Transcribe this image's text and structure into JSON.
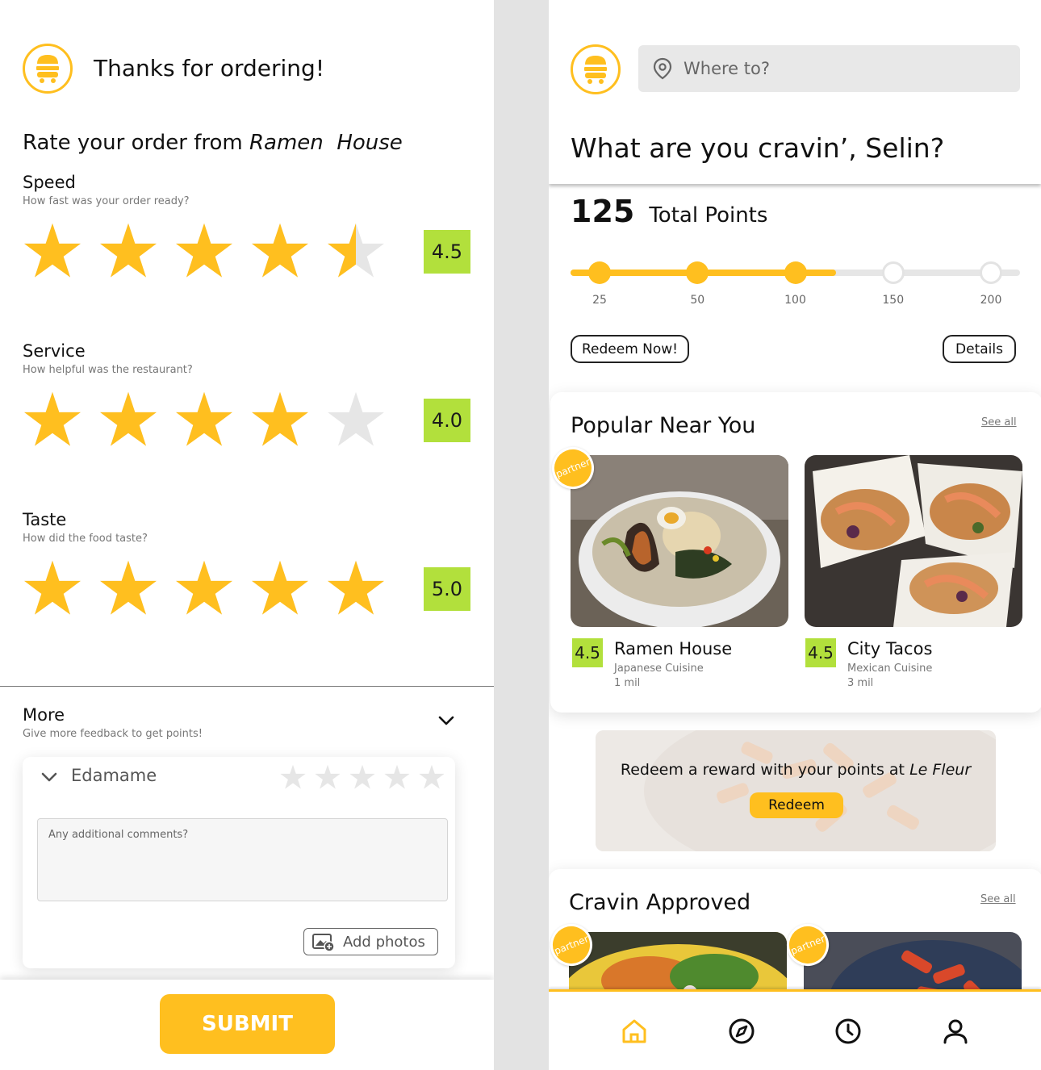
{
  "colors": {
    "accent": "#ffbf1f",
    "rating_green": "#b2e03c",
    "star_empty": "#e6e6e6"
  },
  "left": {
    "header_title": "Thanks for ordering!",
    "rate_prefix": "Rate your order from ",
    "restaurant_name": "Ramen  House",
    "categories": [
      {
        "title": "Speed",
        "subtitle": "How fast was your order ready?",
        "rating": 4.5,
        "score": "4.5"
      },
      {
        "title": "Service",
        "subtitle": "How helpful was the restaurant?",
        "rating": 4.0,
        "score": "4.0"
      },
      {
        "title": "Taste",
        "subtitle": "How did the food taste?",
        "rating": 5.0,
        "score": "5.0"
      }
    ],
    "more": {
      "title": "More",
      "subtitle": "Give more feedback to get points!",
      "item_name": "Edamame",
      "item_rating": 0,
      "comment_placeholder": "Any additional comments?",
      "add_photos_label": "Add photos"
    },
    "submit_label": "SUBMIT"
  },
  "right": {
    "search_placeholder": "Where to?",
    "greeting": "What are you cravin’, Selin?",
    "points_value": "125",
    "points_label": "Total Points",
    "progress": {
      "milestones": [
        "25",
        "50",
        "100",
        "150",
        "200"
      ],
      "reached_count": 3,
      "fill_fraction": 0.59
    },
    "redeem_now_label": "Redeem Now!",
    "details_label": "Details",
    "popular": {
      "title": "Popular Near You",
      "see_all": "See all",
      "partner_label": "partner",
      "items": [
        {
          "rating": "4.5",
          "name": "Ramen House",
          "cuisine": "Japanese Cuisine",
          "distance": "1 mil"
        },
        {
          "rating": "4.5",
          "name": "City Tacos",
          "cuisine": "Mexican Cuisine",
          "distance": "3 mil"
        }
      ]
    },
    "reward_banner": {
      "text_prefix": "Redeem a reward with your points at ",
      "place": "Le Fleur",
      "button_label": "Redeem"
    },
    "approved": {
      "title": "Cravin Approved",
      "see_all": "See all",
      "partner_label": "partner"
    },
    "nav": [
      {
        "icon": "home-icon",
        "active": true
      },
      {
        "icon": "compass-icon",
        "active": false
      },
      {
        "icon": "clock-icon",
        "active": false
      },
      {
        "icon": "profile-icon",
        "active": false
      }
    ]
  }
}
